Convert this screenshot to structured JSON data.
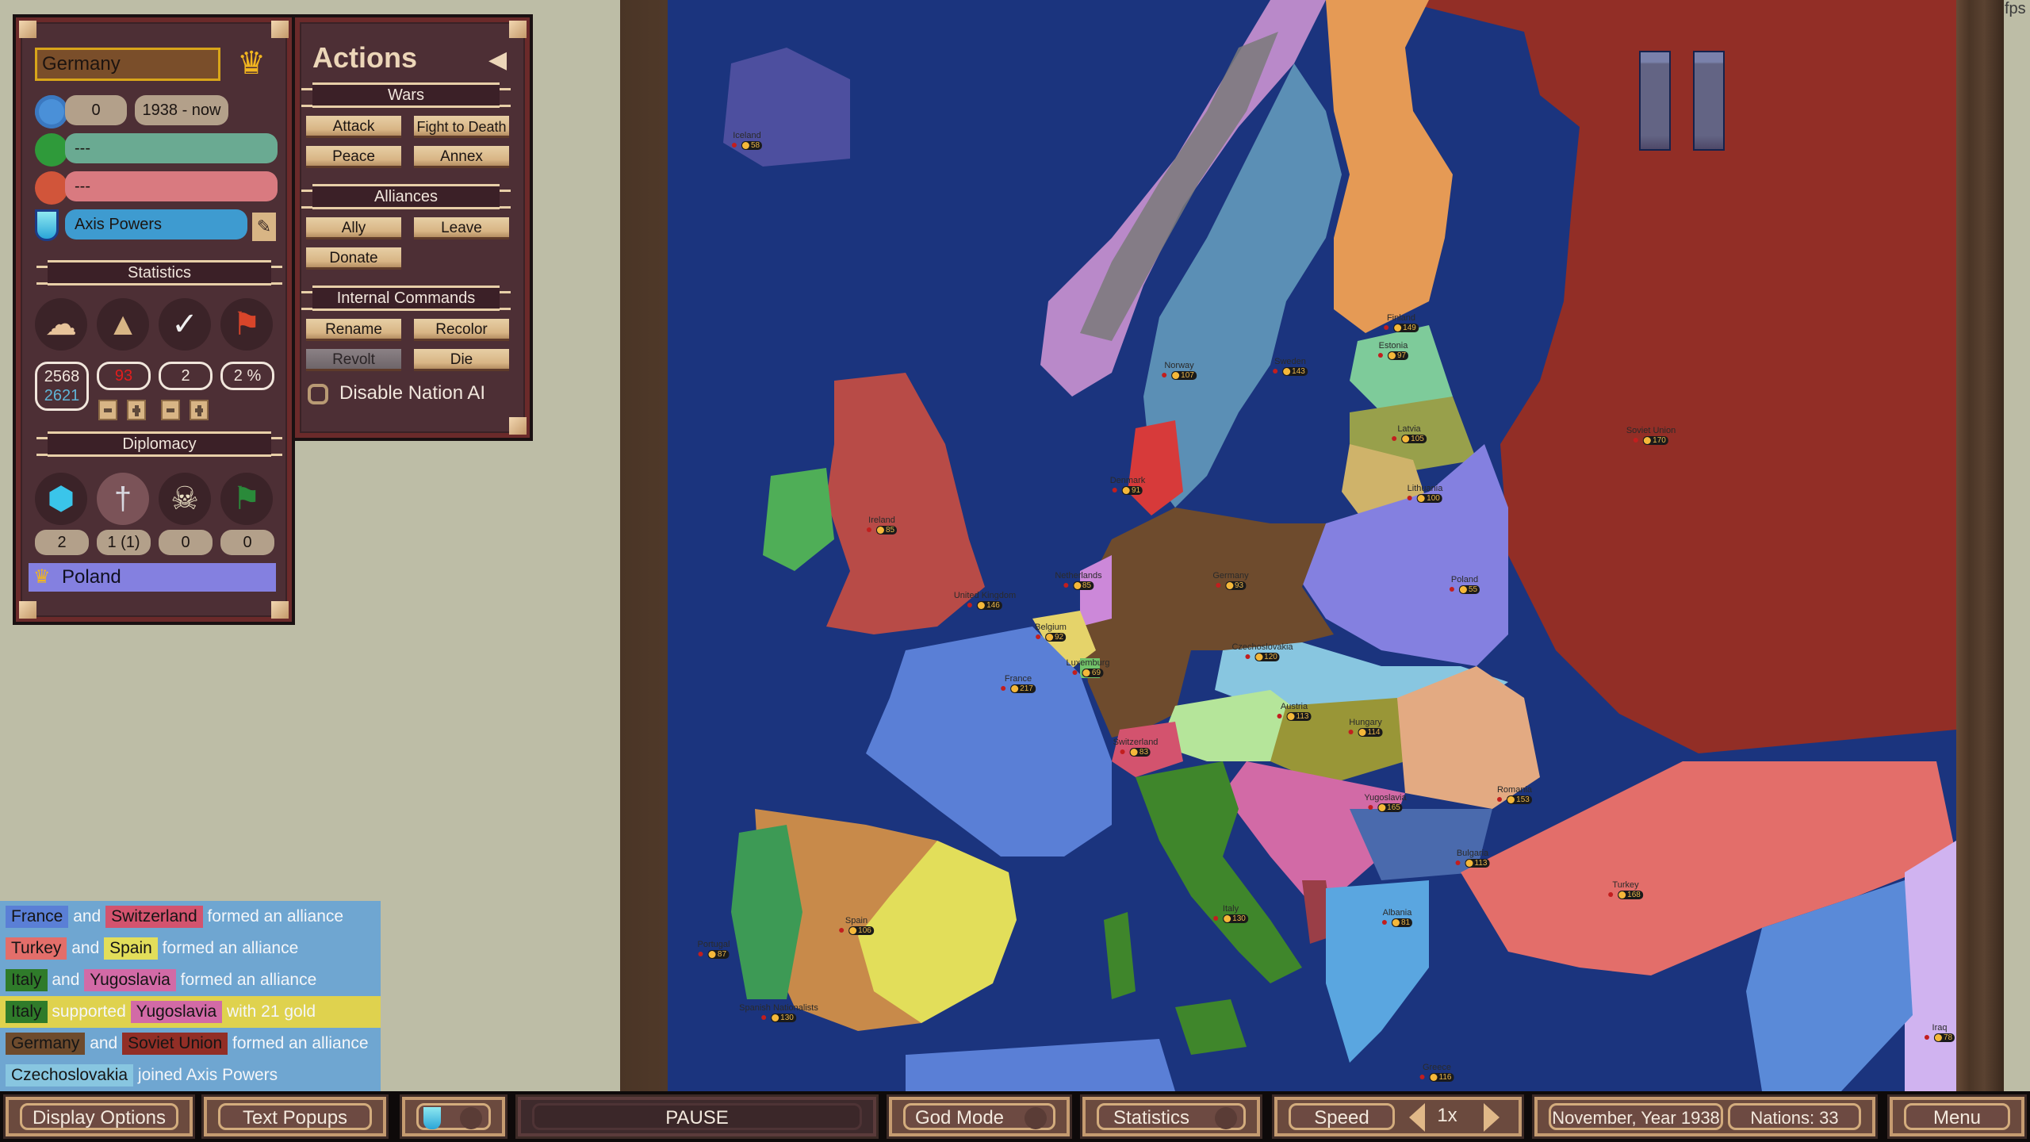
{
  "nation_panel": {
    "name": "Germany",
    "icons": {
      "leader": "crown-icon",
      "age": "clock-icon",
      "allies": "flag-icon",
      "enemies": "skull-icon",
      "alliance": "shield-icon",
      "edit": "pencil-icon"
    },
    "wars_count": "0",
    "period": "1938 - now",
    "allies_value": "---",
    "enemies_value": "---",
    "alliance_name": "Axis Powers",
    "statistics_title": "Statistics",
    "stats": {
      "population": "2568",
      "population_max": "2621",
      "gold": "93",
      "military": "2",
      "tax": "2 %"
    },
    "diplomacy_title": "Diplomacy",
    "diplomacy": [
      {
        "icon": "shield-icon",
        "value": "2"
      },
      {
        "icon": "sword-icon",
        "value": "1 (1)"
      },
      {
        "icon": "skull-icon",
        "value": "0"
      },
      {
        "icon": "flag-icon",
        "value": "0"
      }
    ],
    "selected_target": "Poland",
    "colors": {
      "name_field": "#7a4e2a",
      "allies_bar": "#6aaa92",
      "enemies_bar": "#d97a80",
      "alliance_bar": "#3e9bd0",
      "target_bar": "#8480e0"
    }
  },
  "actions_panel": {
    "title": "Actions",
    "wars_title": "Wars",
    "wars_buttons": [
      "Attack",
      "Fight to Death",
      "Peace",
      "Annex"
    ],
    "alliances_title": "Alliances",
    "alliances_buttons": [
      "Ally",
      "Leave",
      "Donate"
    ],
    "internal_title": "Internal Commands",
    "internal_buttons": [
      "Rename",
      "Recolor",
      "Revolt",
      "Die"
    ],
    "disable_ai_label": "Disable Nation AI",
    "disable_ai_checked": false
  },
  "event_log": [
    {
      "parts": [
        {
          "tag": "France",
          "color": "#5a7fd6"
        },
        {
          "text": " and "
        },
        {
          "tag": "Switzerland",
          "color": "#d3536e"
        },
        {
          "text": " formed an alliance"
        }
      ]
    },
    {
      "parts": [
        {
          "tag": "Turkey",
          "color": "#e36e6a"
        },
        {
          "text": " and "
        },
        {
          "tag": "Spain",
          "color": "#e2de5a"
        },
        {
          "text": " formed an alliance"
        }
      ]
    },
    {
      "parts": [
        {
          "tag": "Italy",
          "color": "#2f7b2a"
        },
        {
          "text": " and "
        },
        {
          "tag": "Yugoslavia",
          "color": "#d26aa6"
        },
        {
          "text": " formed an alliance"
        }
      ]
    },
    {
      "highlight": true,
      "parts": [
        {
          "tag": "Italy",
          "color": "#2f7b2a"
        },
        {
          "text": " supported "
        },
        {
          "tag": "Yugoslavia",
          "color": "#d26aa6"
        },
        {
          "text": " with 21 gold"
        }
      ]
    },
    {
      "parts": [
        {
          "tag": "Germany",
          "color": "#6e4b2d"
        },
        {
          "text": " and "
        },
        {
          "tag": "Soviet Union",
          "color": "#922e26"
        },
        {
          "text": " formed an alliance"
        }
      ]
    },
    {
      "parts": [
        {
          "tag": "Czechoslovakia",
          "color": "#88c6e0"
        },
        {
          "text": " joined Axis Powers"
        }
      ]
    }
  ],
  "map": {
    "fps_label": "fps",
    "paused_icon": "pause-icon",
    "countries": [
      {
        "name": "Iceland",
        "gold": "58",
        "color": "#4d4f9f"
      },
      {
        "name": "Norway",
        "gold": "107",
        "color": "#b989c9"
      },
      {
        "name": "Sweden",
        "gold": "143",
        "color": "#5b8fb5"
      },
      {
        "name": "Finland",
        "gold": "149",
        "color": "#e59a55"
      },
      {
        "name": "Estonia",
        "gold": "97",
        "color": "#7ecb9a"
      },
      {
        "name": "Latvia",
        "gold": "105",
        "color": "#98a04b"
      },
      {
        "name": "Lithuania",
        "gold": "100",
        "color": "#cfb36a"
      },
      {
        "name": "Denmark",
        "gold": "91",
        "color": "#d73a3a"
      },
      {
        "name": "Ireland",
        "gold": "85",
        "color": "#4fae57"
      },
      {
        "name": "United Kingdom",
        "gold": "146",
        "color": "#b84b47"
      },
      {
        "name": "Netherlands",
        "gold": "85",
        "color": "#cc88d9"
      },
      {
        "name": "Belgium",
        "gold": "92",
        "color": "#e5d36a"
      },
      {
        "name": "Luxemburg",
        "gold": "69",
        "color": "#72c46a"
      },
      {
        "name": "France",
        "gold": "217",
        "color": "#5a7fd6"
      },
      {
        "name": "Germany",
        "gold": "93",
        "color": "#6e4b2d"
      },
      {
        "name": "Poland",
        "gold": "55",
        "color": "#8480e0"
      },
      {
        "name": "Czechoslovakia",
        "gold": "120",
        "color": "#88c6e0"
      },
      {
        "name": "Austria",
        "gold": "113",
        "color": "#b5e59a"
      },
      {
        "name": "Hungary",
        "gold": "114",
        "color": "#999637"
      },
      {
        "name": "Switzerland",
        "gold": "83",
        "color": "#d3536e"
      },
      {
        "name": "Yugoslavia",
        "gold": "165",
        "color": "#d26aa6"
      },
      {
        "name": "Romania",
        "gold": "153",
        "color": "#e3aa82"
      },
      {
        "name": "Bulgaria",
        "gold": "113",
        "color": "#4a6aad"
      },
      {
        "name": "Albania",
        "gold": "81",
        "color": "#9a3e47"
      },
      {
        "name": "Greece",
        "gold": "116",
        "color": "#5aa6e0"
      },
      {
        "name": "Italy",
        "gold": "130",
        "color": "#3f862b"
      },
      {
        "name": "Spain",
        "gold": "106",
        "color": "#e2de5a"
      },
      {
        "name": "Spanish Nationalists",
        "gold": "130",
        "color": "#c88a4a"
      },
      {
        "name": "Portugal",
        "gold": "87",
        "color": "#3d9a55"
      },
      {
        "name": "Turkey",
        "gold": "168",
        "color": "#e36e6a"
      },
      {
        "name": "Iraq",
        "gold": "78",
        "color": "#d0b3f0"
      },
      {
        "name": "Soviet Union",
        "gold": "170",
        "color": "#922e26"
      }
    ],
    "sea_color": "#1b347e"
  },
  "bottom_bar": {
    "display_options": "Display Options",
    "text_popups": "Text Popups",
    "pause": "PAUSE",
    "god_mode": "God Mode",
    "statistics": "Statistics",
    "speed_label": "Speed",
    "speed_value": "1x",
    "date": "November, Year 1938",
    "nations": "Nations: 33",
    "menu": "Menu"
  }
}
